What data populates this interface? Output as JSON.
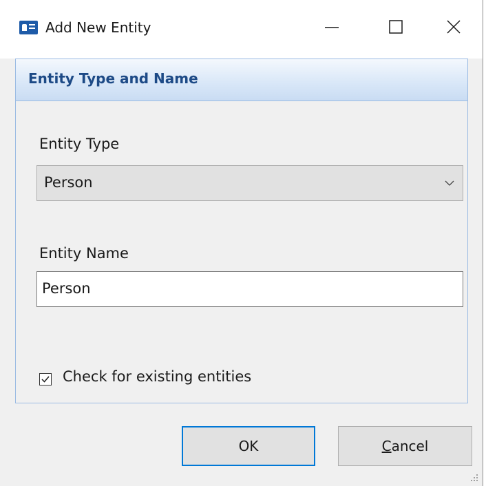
{
  "window": {
    "title": "Add New Entity",
    "icon": "id-card-icon",
    "controls": [
      "minimize-icon",
      "maximize-icon",
      "close-icon"
    ]
  },
  "group": {
    "title": "Entity Type and Name"
  },
  "entity_type": {
    "label": "Entity Type",
    "selected": "Person"
  },
  "entity_name": {
    "label": "Entity Name",
    "value": "Person"
  },
  "check_existing": {
    "label": "Check for existing entities",
    "checked": true
  },
  "buttons": {
    "ok": "OK",
    "cancel_mnemonic": "C",
    "cancel_rest": "ancel"
  },
  "colors": {
    "group_title": "#1d4a86",
    "group_border": "#9bbbe3",
    "focus_border": "#0078d7",
    "app_icon": "#1e5ba8"
  }
}
